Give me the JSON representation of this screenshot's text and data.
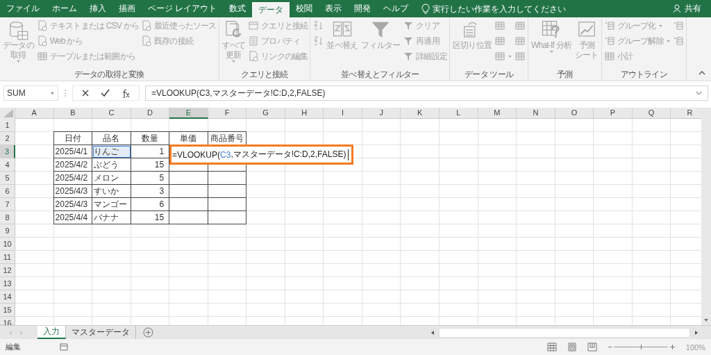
{
  "ribbon_tabs": [
    {
      "label": "ファイル",
      "selected": false
    },
    {
      "label": "ホーム",
      "selected": false
    },
    {
      "label": "挿入",
      "selected": false
    },
    {
      "label": "描画",
      "selected": false
    },
    {
      "label": "ページ レイアウト",
      "selected": false
    },
    {
      "label": "数式",
      "selected": false
    },
    {
      "label": "データ",
      "selected": true
    },
    {
      "label": "校閲",
      "selected": false
    },
    {
      "label": "表示",
      "selected": false
    },
    {
      "label": "開発",
      "selected": false
    },
    {
      "label": "ヘルプ",
      "selected": false
    }
  ],
  "tell_me": {
    "placeholder": "実行したい作業を入力してください"
  },
  "share": "共有",
  "ribbon_groups": [
    {
      "title": "データの取得と変換",
      "items": [
        {
          "kind": "large",
          "lines": [
            "データの",
            "取得"
          ],
          "dropdown": true
        },
        {
          "kind": "small",
          "label": "テキストまたは CSV から",
          "dropdown": false
        },
        {
          "kind": "small",
          "label": "Web から",
          "dropdown": false
        },
        {
          "kind": "small",
          "label": "テーブルまたは範囲から",
          "dropdown": false
        },
        {
          "kind": "small",
          "label": "最近使ったソース",
          "dropdown": false
        },
        {
          "kind": "small",
          "label": "既存の接続",
          "dropdown": false
        }
      ]
    },
    {
      "title": "クエリと接続",
      "items": [
        {
          "kind": "large",
          "lines": [
            "すべて",
            "更新"
          ],
          "dropdown": true
        },
        {
          "kind": "small",
          "label": "クエリと接続",
          "dropdown": false
        },
        {
          "kind": "small",
          "label": "プロパティ",
          "dropdown": false
        },
        {
          "kind": "small",
          "label": "リンクの編集",
          "dropdown": false
        }
      ]
    },
    {
      "title": "並べ替えとフィルター",
      "items": [
        {
          "kind": "icon",
          "dropdown": false
        },
        {
          "kind": "icon",
          "dropdown": false
        },
        {
          "kind": "large",
          "lines": [
            "並べ替え"
          ],
          "dropdown": false
        },
        {
          "kind": "large",
          "lines": [
            "フィルター"
          ],
          "dropdown": false
        },
        {
          "kind": "small",
          "label": "クリア",
          "dropdown": false
        },
        {
          "kind": "small",
          "label": "再適用",
          "dropdown": false
        },
        {
          "kind": "small",
          "label": "詳細設定",
          "dropdown": false
        }
      ]
    },
    {
      "title": "データ ツール",
      "items": [
        {
          "kind": "large",
          "lines": [
            "区切り位置"
          ],
          "dropdown": false
        },
        {
          "kind": "icon",
          "dropdown": false
        },
        {
          "kind": "icon",
          "dropdown": false
        },
        {
          "kind": "icon",
          "dropdown": true
        },
        {
          "kind": "icon",
          "dropdown": false
        },
        {
          "kind": "icon",
          "dropdown": false
        },
        {
          "kind": "icon",
          "dropdown": false
        }
      ]
    },
    {
      "title": "予測",
      "items": [
        {
          "kind": "large",
          "lines": [
            "What-If 分析"
          ],
          "dropdown": true
        },
        {
          "kind": "large",
          "lines": [
            "予測",
            "シート"
          ],
          "dropdown": false
        }
      ]
    },
    {
      "title": "アウトライン",
      "items": [
        {
          "kind": "small",
          "label": "グループ化",
          "dropdown": true
        },
        {
          "kind": "small",
          "label": "グループ解除",
          "dropdown": true
        },
        {
          "kind": "small",
          "label": "小計",
          "dropdown": false
        },
        {
          "kind": "icon",
          "dropdown": false
        },
        {
          "kind": "icon",
          "dropdown": false
        }
      ]
    }
  ],
  "name_box": "SUM",
  "formula": "=VLOOKUP(C3,マスターデータ!C:D,2,FALSE)",
  "columns": [
    {
      "label": "A",
      "selected": false
    },
    {
      "label": "B",
      "selected": false
    },
    {
      "label": "C",
      "selected": false
    },
    {
      "label": "D",
      "selected": false
    },
    {
      "label": "E",
      "selected": true
    },
    {
      "label": "F",
      "selected": false
    },
    {
      "label": "G",
      "selected": false
    },
    {
      "label": "H",
      "selected": false
    },
    {
      "label": "I",
      "selected": false
    },
    {
      "label": "J",
      "selected": false
    },
    {
      "label": "K",
      "selected": false
    },
    {
      "label": "L",
      "selected": false
    },
    {
      "label": "M",
      "selected": false
    },
    {
      "label": "N",
      "selected": false
    },
    {
      "label": "O",
      "selected": false
    },
    {
      "label": "P",
      "selected": false
    },
    {
      "label": "Q",
      "selected": false
    },
    {
      "label": "R",
      "selected": false
    }
  ],
  "rows": [
    {
      "label": "1",
      "selected": false
    },
    {
      "label": "2",
      "selected": false
    },
    {
      "label": "3",
      "selected": true
    },
    {
      "label": "4",
      "selected": false
    },
    {
      "label": "5",
      "selected": false
    },
    {
      "label": "6",
      "selected": false
    },
    {
      "label": "7",
      "selected": false
    },
    {
      "label": "8",
      "selected": false
    },
    {
      "label": "9",
      "selected": false
    },
    {
      "label": "10",
      "selected": false
    },
    {
      "label": "11",
      "selected": false
    },
    {
      "label": "12",
      "selected": false
    },
    {
      "label": "13",
      "selected": false
    },
    {
      "label": "14",
      "selected": false
    },
    {
      "label": "15",
      "selected": false
    },
    {
      "label": "16",
      "selected": false
    }
  ],
  "table": {
    "header": [
      "日付",
      "品名",
      "数量",
      "単価",
      "商品番号"
    ],
    "rows": [
      [
        {
          "text": "2025/4/1",
          "referenced": false
        },
        {
          "text": "りんご",
          "referenced": true
        },
        {
          "text": "1",
          "referenced": false
        }
      ],
      [
        {
          "text": "2025/4/2",
          "referenced": false
        },
        {
          "text": "ぶどう",
          "referenced": false
        },
        {
          "text": "15",
          "referenced": false
        }
      ],
      [
        {
          "text": "2025/4/2",
          "referenced": false
        },
        {
          "text": "メロン",
          "referenced": false
        },
        {
          "text": "5",
          "referenced": false
        }
      ],
      [
        {
          "text": "2025/4/3",
          "referenced": false
        },
        {
          "text": "すいか",
          "referenced": false
        },
        {
          "text": "3",
          "referenced": false
        }
      ],
      [
        {
          "text": "2025/4/3",
          "referenced": false
        },
        {
          "text": "マンゴー",
          "referenced": false
        },
        {
          "text": "6",
          "referenced": false
        }
      ],
      [
        {
          "text": "2025/4/4",
          "referenced": false
        },
        {
          "text": "バナナ",
          "referenced": false
        },
        {
          "text": "15",
          "referenced": false
        }
      ]
    ]
  },
  "cell_editor": {
    "parts": [
      {
        "text": "=VLOOKUP(",
        "ref": false
      },
      {
        "text": "C3",
        "ref": true
      },
      {
        "text": ",マスターデータ!C:D,2,FALSE)",
        "ref": false
      }
    ]
  },
  "sheet_tabs": [
    {
      "label": "入力",
      "selected": true
    },
    {
      "label": "マスターデータ",
      "selected": false
    }
  ],
  "status": "編集",
  "zoom_slider": {
    "level": 0.5
  },
  "zoom": "100%"
}
